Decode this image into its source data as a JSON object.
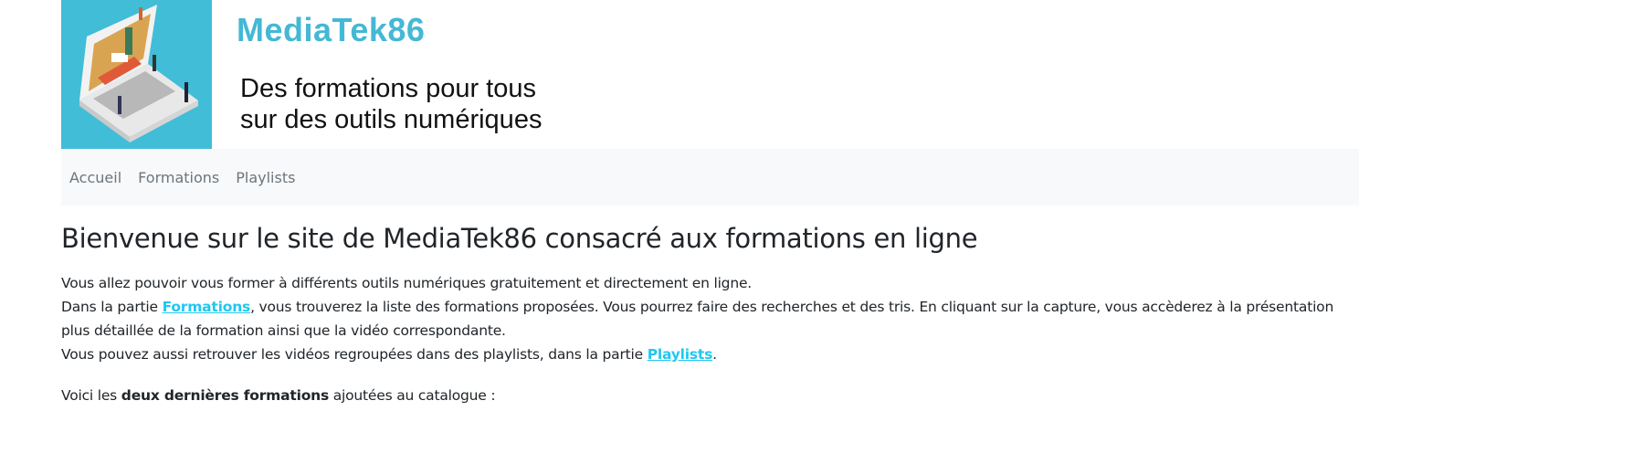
{
  "header": {
    "brand": "MediaTek86",
    "tagline_line1": "Des formations pour tous",
    "tagline_line2": "sur des outils numériques",
    "logo_bg": "#41bdd7"
  },
  "nav": {
    "items": [
      {
        "label": "Accueil"
      },
      {
        "label": "Formations"
      },
      {
        "label": "Playlists"
      }
    ]
  },
  "main": {
    "title": "Bienvenue sur le site de MediaTek86 consacré aux formations en ligne",
    "line1": "Vous allez pouvoir vous former à différents outils numériques gratuitement et directement en ligne.",
    "line2_pre": "Dans la partie ",
    "line2_link": "Formations",
    "line2_post": ", vous trouverez la liste des formations proposées. Vous pourrez faire des recherches et des tris. En cliquant sur la capture, vous accèderez à la présentation plus détaillée de la formation ainsi que la vidéo correspondante.",
    "line3_pre": "Vous pouvez aussi retrouver les vidéos regroupées dans des playlists, dans la partie ",
    "line3_link": "Playlists",
    "line3_post": ".",
    "last_pre": "Voici les ",
    "last_bold": "deux dernières formations",
    "last_post": " ajoutées au catalogue :",
    "link_color": "#1ec8f0"
  }
}
